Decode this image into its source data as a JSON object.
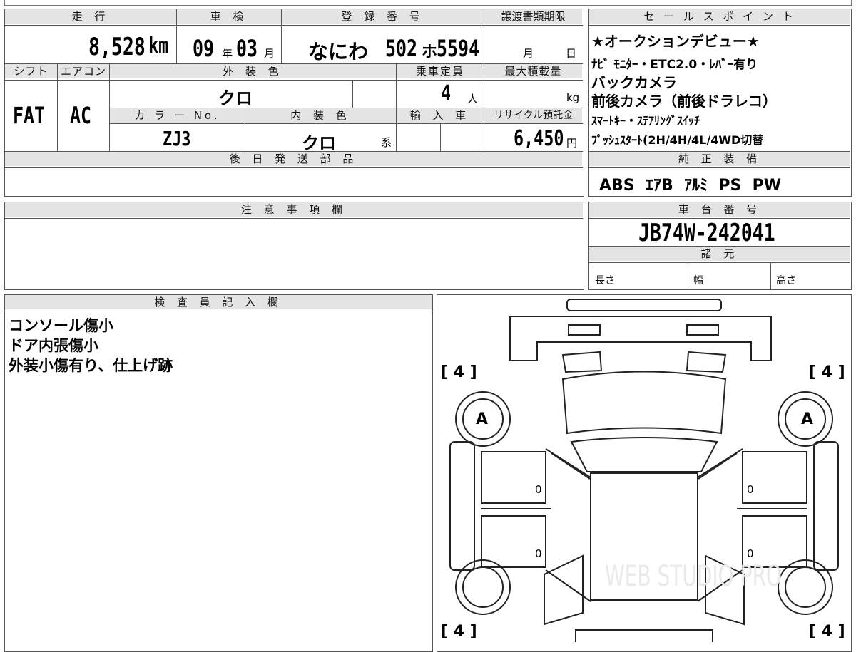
{
  "header": {
    "mileage_label": "走 行",
    "inspection_label": "車 検",
    "registration_label": "登 録 番 号",
    "transfer_deadline_label": "譲渡書類期限",
    "sales_points_label": "セ ー ル ス ポ イ ン ト"
  },
  "vehicle": {
    "mileage": "8,528",
    "mileage_unit": "km",
    "inspection_year": "09",
    "inspection_year_unit": "年",
    "inspection_month": "03",
    "inspection_month_unit": "月",
    "registration_area": "なにわ",
    "registration_class": "502",
    "registration_kana": "ホ",
    "registration_number": "5594",
    "transfer_month_unit": "月",
    "transfer_day_unit": "日"
  },
  "spec": {
    "shift_label": "シフト",
    "aircon_label": "エアコン",
    "exterior_color_label": "外 装 色",
    "capacity_label": "乗車定員",
    "max_load_label": "最大積載量",
    "shift": "FAT",
    "aircon": "AC",
    "exterior_color": "クロ",
    "capacity": "4",
    "capacity_unit": "人",
    "max_load_unit": "kg",
    "color_no_label": "カ ラ ー No.",
    "interior_color_label": "内 装 色",
    "import_label": "輸 入 車",
    "recycle_label": "リサイクル預託金",
    "color_no": "ZJ3",
    "interior_color": "クロ",
    "interior_color_suffix": "系",
    "recycle_fee": "6,450",
    "recycle_unit": "円"
  },
  "sales_points": [
    "★オークションデビュー★",
    "ﾅﾋﾞ ﾓﾆﾀｰ・ETC2.0・ﾚﾊﾞｰ有り",
    "バックカメラ",
    "前後カメラ（前後ドラレコ）",
    "ｽﾏｰﾄｷｰ・ｽﾃｱﾘﾝｸﾞｽｲｯﾁ",
    "ﾌﾟｯｼｭｽﾀｰﾄ(2H/4H/4L/4WD切替"
  ],
  "later_parts_label": "後 日 発 送 部 品",
  "equipment": {
    "label": "純 正 装 備",
    "items": "ABS  ｴｱB  ｱﾙﾐ  PS  PW"
  },
  "notes_label": "注 意 事 項 欄",
  "chassis": {
    "label": "車 台 番 号",
    "number": "JB74W-242041",
    "specs_label": "諸 元",
    "length_label": "長さ",
    "width_label": "幅",
    "height_label": "高さ"
  },
  "inspector": {
    "label": "検 査 員 記 入 欄",
    "lines": [
      "コンソール傷小",
      "ドア内張傷小",
      "外装小傷有り、仕上げ跡"
    ]
  },
  "diagram": {
    "tire_tl": "[ 4 ]",
    "tire_tr": "[ 4 ]",
    "tire_bl": "[ 4 ]",
    "tire_br": "[ 4 ]",
    "mark_left": "A",
    "mark_right": "A",
    "door_fl": "0",
    "door_rl": "0",
    "door_fr": "0",
    "door_rr": "0",
    "watermark": "WEB STUDIO PRO"
  }
}
